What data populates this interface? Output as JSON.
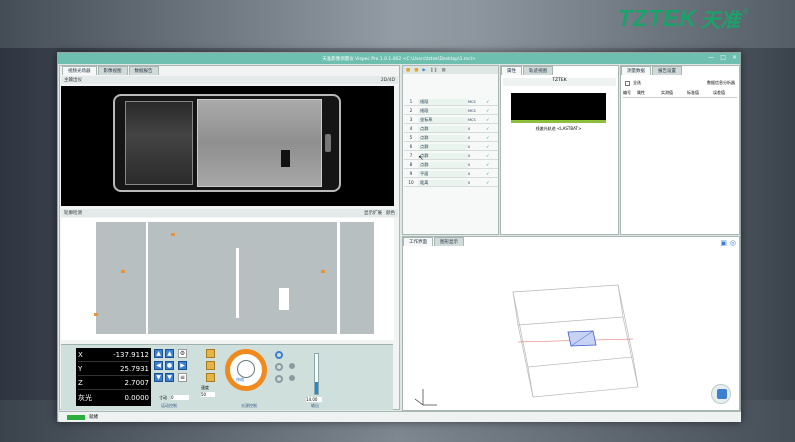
{
  "brand": {
    "name": "TZTEK",
    "cn": "天准",
    "reg": "®"
  },
  "window": {
    "title": "天准影像测量仪 Vispec Pro 1.0.1.002  <C:\\Users\\tztek\\Desktop\\1.mcl>",
    "controls": [
      "—",
      "□",
      "×"
    ]
  },
  "camera": {
    "tabs": [
      "视频光场器",
      "影像视图",
      "数据报告"
    ],
    "toolbar": [
      "主输出仪",
      "2D对齐"
    ],
    "zoom": "2D/4D"
  },
  "pointcloud": {
    "tabs": [
      "轮廓检测"
    ],
    "toolbar_right": [
      "显示扩展",
      "颜色"
    ]
  },
  "dro": {
    "rows": [
      {
        "axis": "X",
        "value": "-137.9112"
      },
      {
        "axis": "Y",
        "value": "25.7931"
      },
      {
        "axis": "Z",
        "value": "2.7007"
      },
      {
        "axis": "灰光",
        "value": "0.0000"
      }
    ]
  },
  "controls": {
    "speed_label": "速度",
    "speed_value": "50",
    "step_label": "寸动",
    "step_value": "0",
    "dial_label": "伸缩",
    "sect1": "运动控制",
    "sect2": "光源控制",
    "sect3": "输出",
    "slider_value": "14.00"
  },
  "status": {
    "text": "就绪"
  },
  "list": {
    "rows": [
      {
        "no": "1",
        "name": "线段",
        "tag": "MCS"
      },
      {
        "no": "2",
        "name": "线段",
        "tag": "MCS"
      },
      {
        "no": "3",
        "name": "坐标系",
        "tag": "MCS"
      },
      {
        "no": "4",
        "name": "点群",
        "tag": "0"
      },
      {
        "no": "5",
        "name": "点群",
        "tag": "0"
      },
      {
        "no": "6",
        "name": "点群",
        "tag": "0"
      },
      {
        "no": "7",
        "name": "点群",
        "tag": "0"
      },
      {
        "no": "8",
        "name": "点群",
        "tag": "0"
      },
      {
        "no": "9",
        "name": "平面",
        "tag": "0"
      },
      {
        "no": "10",
        "name": "距离",
        "tag": "0"
      }
    ]
  },
  "props": {
    "tabs": [
      "属性",
      "轨迹视图"
    ],
    "header": "TZTEK",
    "caption": "线激光轨迹 <LASTBAT>"
  },
  "data": {
    "tabs": [
      "测量数据",
      "报告设置"
    ],
    "opt_label": "全选",
    "opt_right": "数据信息分析器",
    "columns": [
      "编号",
      "属性",
      "实测值",
      "标准值",
      "误差值"
    ]
  },
  "view3d": {
    "tabs": [
      "工作界面",
      "图形显示"
    ]
  },
  "colors": {
    "accent": "#6fbfb0",
    "orange": "#f08a1c",
    "blue": "#3d7fd0",
    "ok": "#1a9a43"
  }
}
